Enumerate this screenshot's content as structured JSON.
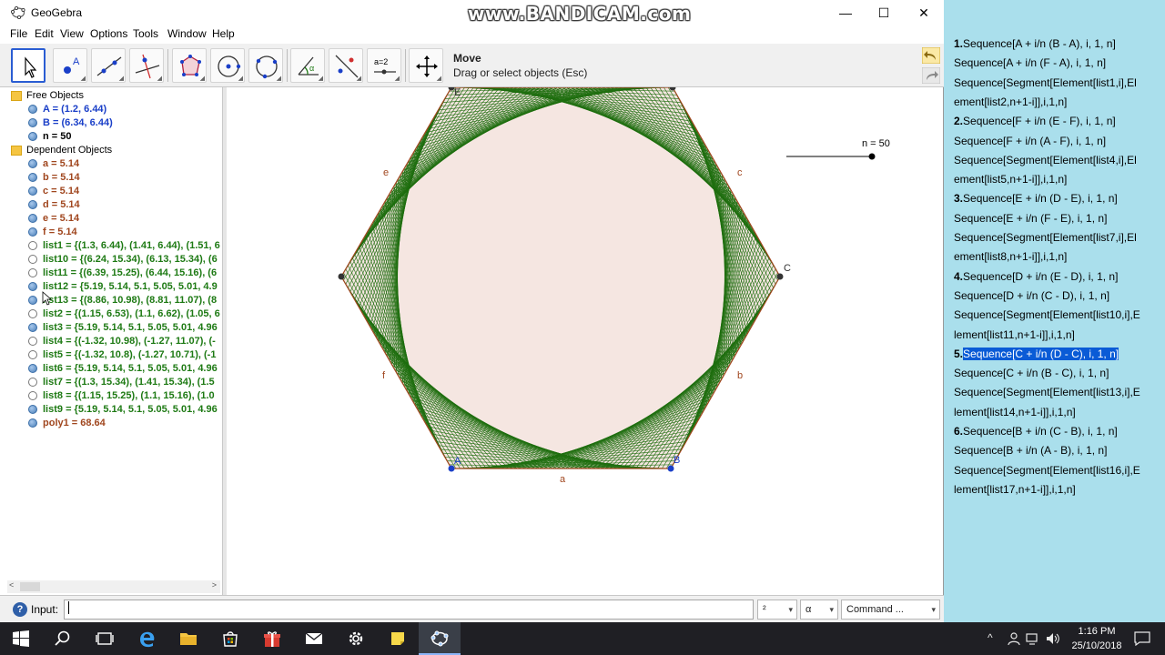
{
  "watermark": "www.BANDICAM.com",
  "window": {
    "title": "GeoGebra",
    "minimize": "—",
    "maximize": "☐",
    "close": "✕"
  },
  "menu": [
    "File",
    "Edit",
    "View",
    "Options",
    "Tools",
    "Window",
    "Help"
  ],
  "toolbar": {
    "active_tool_name": "Move",
    "active_tool_desc": "Drag or select objects (Esc)",
    "tools": [
      "move-tool",
      "point-tool",
      "line-tool",
      "perpendicular-line-tool",
      "polygon-tool",
      "circle-tool",
      "circle-through-points-tool",
      "angle-tool",
      "reflect-tool",
      "slider-tool",
      "move-graphics-view-tool"
    ],
    "slider_tool_text": "a=2"
  },
  "algebra": {
    "free_header": "Free Objects",
    "dependent_header": "Dependent Objects",
    "free": [
      {
        "label": "A = (1.2, 6.44)",
        "color": "blue",
        "visible": true
      },
      {
        "label": "B = (6.34, 6.44)",
        "color": "blue",
        "visible": true
      },
      {
        "label": "n = 50",
        "color": "black",
        "visible": true
      }
    ],
    "dependent": [
      {
        "label": "a = 5.14",
        "color": "brown",
        "visible": true
      },
      {
        "label": "b = 5.14",
        "color": "brown",
        "visible": true
      },
      {
        "label": "c = 5.14",
        "color": "brown",
        "visible": true
      },
      {
        "label": "d = 5.14",
        "color": "brown",
        "visible": true
      },
      {
        "label": "e = 5.14",
        "color": "brown",
        "visible": true
      },
      {
        "label": "f = 5.14",
        "color": "brown",
        "visible": true
      },
      {
        "label": "list1 = {(1.3, 6.44), (1.41, 6.44), (1.51, 6",
        "color": "green",
        "visible": false
      },
      {
        "label": "list10 = {(6.24, 15.34), (6.13, 15.34), (6",
        "color": "green",
        "visible": false
      },
      {
        "label": "list11 = {(6.39, 15.25), (6.44, 15.16), (6",
        "color": "green",
        "visible": false
      },
      {
        "label": "list12 = {5.19, 5.14, 5.1, 5.05, 5.01, 4.9",
        "color": "green",
        "visible": true
      },
      {
        "label": "list13 = {(8.86, 10.98), (8.81, 11.07), (8",
        "color": "green",
        "visible": true
      },
      {
        "label": "list2 = {(1.15, 6.53), (1.1, 6.62), (1.05, 6",
        "color": "green",
        "visible": false
      },
      {
        "label": "list3 = {5.19, 5.14, 5.1, 5.05, 5.01, 4.96",
        "color": "green",
        "visible": true
      },
      {
        "label": "list4 = {(-1.32, 10.98), (-1.27, 11.07), (-",
        "color": "green",
        "visible": false
      },
      {
        "label": "list5 = {(-1.32, 10.8), (-1.27, 10.71), (-1",
        "color": "green",
        "visible": false
      },
      {
        "label": "list6 = {5.19, 5.14, 5.1, 5.05, 5.01, 4.96",
        "color": "green",
        "visible": true
      },
      {
        "label": "list7 = {(1.3, 15.34), (1.41, 15.34), (1.5",
        "color": "green",
        "visible": false
      },
      {
        "label": "list8 = {(1.15, 15.25), (1.1, 15.16), (1.0",
        "color": "green",
        "visible": false
      },
      {
        "label": "list9 = {5.19, 5.14, 5.1, 5.05, 5.01, 4.96",
        "color": "green",
        "visible": true
      },
      {
        "label": "poly1 = 68.64",
        "color": "brown",
        "visible": true
      }
    ]
  },
  "graphics": {
    "slider_label": "n = 50",
    "slider_value": 50,
    "segment_labels": {
      "a": "a",
      "b": "b",
      "c": "c",
      "e": "e",
      "f": "f"
    },
    "point_labels": {
      "A": "A",
      "B": "B",
      "C": "C",
      "E": "E"
    },
    "colors": {
      "envelope": "#1e6e0e",
      "fill": "#f5e6e1",
      "edge": "#a0461e",
      "point": "#1a3fc8"
    }
  },
  "inputbar": {
    "label": "Input:",
    "value": "",
    "combo1": "²",
    "combo2": "α",
    "combo3": "Command ..."
  },
  "notes": [
    {
      "num": "1.",
      "text": "Sequence[A + i/n (B - A), i, 1, n]"
    },
    {
      "num": "",
      "text": "Sequence[A + i/n (F - A), i, 1, n]"
    },
    {
      "num": "",
      "text": "Sequence[Segment[Element[list1,i],El"
    },
    {
      "num": "",
      "text": "ement[list2,n+1-i]],i,1,n]"
    },
    {
      "num": "2.",
      "text": "Sequence[F + i/n (E - F), i, 1, n]"
    },
    {
      "num": "",
      "text": "Sequence[F + i/n (A - F), i, 1, n]"
    },
    {
      "num": "",
      "text": "Sequence[Segment[Element[list4,i],El"
    },
    {
      "num": "",
      "text": "ement[list5,n+1-i]],i,1,n]"
    },
    {
      "num": "3.",
      "text": "Sequence[E + i/n (D - E), i, 1, n]"
    },
    {
      "num": "",
      "text": "Sequence[E + i/n (F - E), i, 1, n]"
    },
    {
      "num": "",
      "text": "Sequence[Segment[Element[list7,i],El"
    },
    {
      "num": "",
      "text": "ement[list8,n+1-i]],i,1,n]"
    },
    {
      "num": "4.",
      "text": "Sequence[D + i/n (E - D), i, 1, n]"
    },
    {
      "num": "",
      "text": "Sequence[D + i/n (C - D), i, 1, n]"
    },
    {
      "num": "",
      "text": "Sequence[Segment[Element[list10,i],E"
    },
    {
      "num": "",
      "text": "lement[list11,n+1-i]],i,1,n]"
    },
    {
      "num": "5.",
      "text": "Sequence[C + i/n (D - C), i, 1, n]",
      "highlight": true
    },
    {
      "num": "",
      "text": "Sequence[C + i/n (B - C), i, 1, n]"
    },
    {
      "num": "",
      "text": "Sequence[Segment[Element[list13,i],E"
    },
    {
      "num": "",
      "text": "lement[list14,n+1-i]],i,1,n]"
    },
    {
      "num": "6.",
      "text": "Sequence[B + i/n (C - B), i, 1, n]"
    },
    {
      "num": "",
      "text": "Sequence[B + i/n (A - B), i, 1, n]"
    },
    {
      "num": "",
      "text": "Sequence[Segment[Element[list16,i],E"
    },
    {
      "num": "",
      "text": "lement[list17,n+1-i]],i,1,n]"
    }
  ],
  "taskbar": {
    "apps": [
      "windows-start-icon",
      "search-icon",
      "task-view-icon",
      "edge-icon",
      "file-explorer-icon",
      "store-icon",
      "gift-icon",
      "mail-icon",
      "settings-icon",
      "sticky-notes-icon",
      "geogebra-icon"
    ],
    "time": "1:16 PM",
    "date": "25/10/2018"
  }
}
